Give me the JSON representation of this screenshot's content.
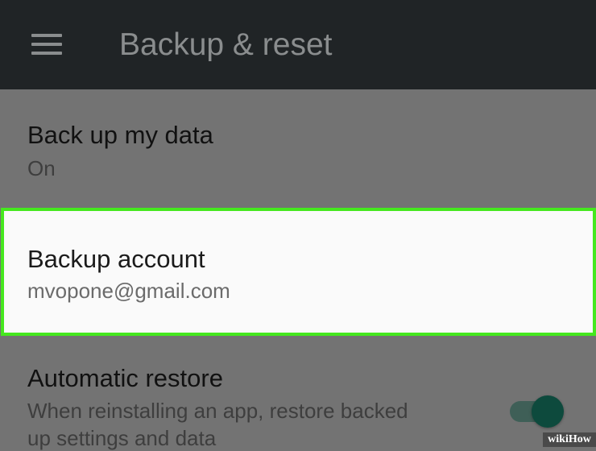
{
  "app_bar": {
    "title": "Backup & reset",
    "menu_icon": "hamburger-menu-icon",
    "background": "#202426"
  },
  "settings": [
    {
      "title": "Back up my data",
      "summary": "On"
    },
    {
      "title": "Backup account",
      "summary": "mvopone@gmail.com",
      "highlighted": true
    },
    {
      "title": "Automatic restore",
      "summary_line1": "When reinstalling an app, restore backed",
      "summary_line2": "up settings and data",
      "toggle": "on"
    }
  ],
  "colors": {
    "dimmed_background": "#737373",
    "highlight_border": "#45e81e",
    "toggle_accent": "#0d4a3d"
  },
  "watermark": {
    "text": "wikiHow"
  }
}
